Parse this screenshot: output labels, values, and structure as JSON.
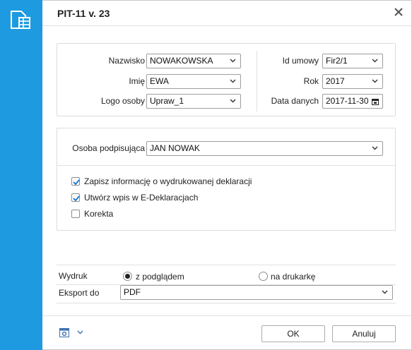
{
  "window": {
    "title": "PIT-11 v. 23"
  },
  "person": {
    "surname_label": "Nazwisko",
    "surname_value": "NOWAKOWSKA",
    "firstname_label": "Imię",
    "firstname_value": "EWA",
    "logo_label": "Logo osoby",
    "logo_value": "Upraw_1"
  },
  "contract": {
    "id_label": "Id umowy",
    "id_value": "Fir2/1",
    "year_label": "Rok",
    "year_value": "2017",
    "date_label": "Data danych",
    "date_value": "2017-11-30"
  },
  "signing": {
    "label": "Osoba podpisująca",
    "value": "JAN NOWAK"
  },
  "options": [
    {
      "label": "Zapisz informację o wydrukowanej deklaracji",
      "checked": true
    },
    {
      "label": "Utwórz wpis w E-Deklaracjach",
      "checked": true
    },
    {
      "label": "Korekta",
      "checked": false
    }
  ],
  "print": {
    "label": "Wydruk",
    "option_preview": "z podglądem",
    "option_printer": "na drukarkę",
    "selected": "z podglądem"
  },
  "export": {
    "label": "Eksport do",
    "value": "PDF"
  },
  "footer": {
    "ok_label": "OK",
    "cancel_label": "Anuluj"
  },
  "colors": {
    "sidebar": "#1e9ae0",
    "check": "#1a73c9"
  }
}
